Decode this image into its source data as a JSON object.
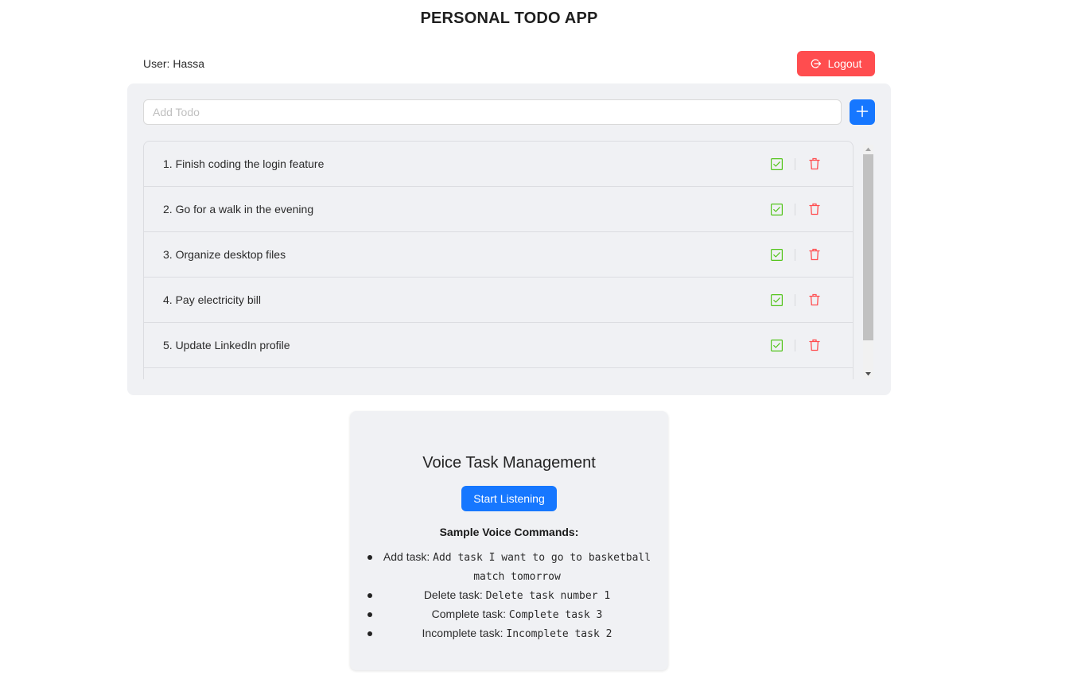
{
  "app": {
    "title": "PERSONAL TODO APP"
  },
  "header": {
    "user_label": "User: Hassa",
    "logout_label": "Logout"
  },
  "add_todo": {
    "placeholder": "Add Todo",
    "value": ""
  },
  "todos": [
    {
      "text": "1. Finish coding the login feature"
    },
    {
      "text": "2. Go for a walk in the evening"
    },
    {
      "text": "3. Organize desktop files"
    },
    {
      "text": "4. Pay electricity bill"
    },
    {
      "text": "5. Update LinkedIn profile"
    }
  ],
  "voice": {
    "title": "Voice Task Management",
    "start_label": "Start Listening",
    "samples_heading": "Sample Voice Commands:",
    "commands": [
      {
        "label": "Add task: ",
        "example": "Add task I want to go to basketball match tomorrow"
      },
      {
        "label": "Delete task: ",
        "example": "Delete task number 1"
      },
      {
        "label": "Complete task: ",
        "example": "Complete task 3"
      },
      {
        "label": "Incomplete task: ",
        "example": "Incomplete task 2"
      }
    ]
  },
  "colors": {
    "primary": "#1677ff",
    "danger": "#ff4d4f",
    "success": "#52c41a",
    "panel_bg": "#f0f1f4"
  },
  "icons": {
    "logout": "logout-icon",
    "add": "plus-icon",
    "complete": "check-square-icon",
    "delete": "trash-icon"
  }
}
